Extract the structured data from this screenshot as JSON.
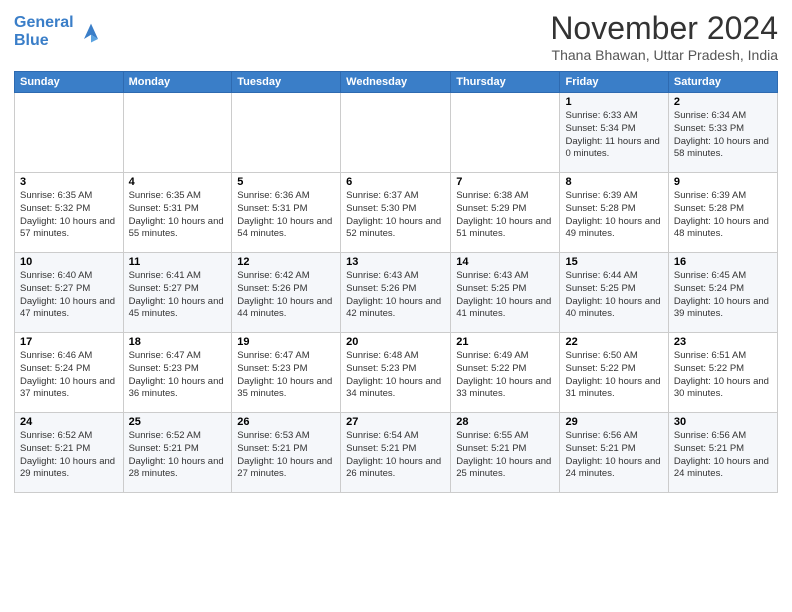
{
  "logo": {
    "line1": "General",
    "line2": "Blue"
  },
  "title": "November 2024",
  "subtitle": "Thana Bhawan, Uttar Pradesh, India",
  "weekdays": [
    "Sunday",
    "Monday",
    "Tuesday",
    "Wednesday",
    "Thursday",
    "Friday",
    "Saturday"
  ],
  "weeks": [
    [
      {
        "day": "",
        "info": ""
      },
      {
        "day": "",
        "info": ""
      },
      {
        "day": "",
        "info": ""
      },
      {
        "day": "",
        "info": ""
      },
      {
        "day": "",
        "info": ""
      },
      {
        "day": "1",
        "info": "Sunrise: 6:33 AM\nSunset: 5:34 PM\nDaylight: 11 hours and 0 minutes."
      },
      {
        "day": "2",
        "info": "Sunrise: 6:34 AM\nSunset: 5:33 PM\nDaylight: 10 hours and 58 minutes."
      }
    ],
    [
      {
        "day": "3",
        "info": "Sunrise: 6:35 AM\nSunset: 5:32 PM\nDaylight: 10 hours and 57 minutes."
      },
      {
        "day": "4",
        "info": "Sunrise: 6:35 AM\nSunset: 5:31 PM\nDaylight: 10 hours and 55 minutes."
      },
      {
        "day": "5",
        "info": "Sunrise: 6:36 AM\nSunset: 5:31 PM\nDaylight: 10 hours and 54 minutes."
      },
      {
        "day": "6",
        "info": "Sunrise: 6:37 AM\nSunset: 5:30 PM\nDaylight: 10 hours and 52 minutes."
      },
      {
        "day": "7",
        "info": "Sunrise: 6:38 AM\nSunset: 5:29 PM\nDaylight: 10 hours and 51 minutes."
      },
      {
        "day": "8",
        "info": "Sunrise: 6:39 AM\nSunset: 5:28 PM\nDaylight: 10 hours and 49 minutes."
      },
      {
        "day": "9",
        "info": "Sunrise: 6:39 AM\nSunset: 5:28 PM\nDaylight: 10 hours and 48 minutes."
      }
    ],
    [
      {
        "day": "10",
        "info": "Sunrise: 6:40 AM\nSunset: 5:27 PM\nDaylight: 10 hours and 47 minutes."
      },
      {
        "day": "11",
        "info": "Sunrise: 6:41 AM\nSunset: 5:27 PM\nDaylight: 10 hours and 45 minutes."
      },
      {
        "day": "12",
        "info": "Sunrise: 6:42 AM\nSunset: 5:26 PM\nDaylight: 10 hours and 44 minutes."
      },
      {
        "day": "13",
        "info": "Sunrise: 6:43 AM\nSunset: 5:26 PM\nDaylight: 10 hours and 42 minutes."
      },
      {
        "day": "14",
        "info": "Sunrise: 6:43 AM\nSunset: 5:25 PM\nDaylight: 10 hours and 41 minutes."
      },
      {
        "day": "15",
        "info": "Sunrise: 6:44 AM\nSunset: 5:25 PM\nDaylight: 10 hours and 40 minutes."
      },
      {
        "day": "16",
        "info": "Sunrise: 6:45 AM\nSunset: 5:24 PM\nDaylight: 10 hours and 39 minutes."
      }
    ],
    [
      {
        "day": "17",
        "info": "Sunrise: 6:46 AM\nSunset: 5:24 PM\nDaylight: 10 hours and 37 minutes."
      },
      {
        "day": "18",
        "info": "Sunrise: 6:47 AM\nSunset: 5:23 PM\nDaylight: 10 hours and 36 minutes."
      },
      {
        "day": "19",
        "info": "Sunrise: 6:47 AM\nSunset: 5:23 PM\nDaylight: 10 hours and 35 minutes."
      },
      {
        "day": "20",
        "info": "Sunrise: 6:48 AM\nSunset: 5:23 PM\nDaylight: 10 hours and 34 minutes."
      },
      {
        "day": "21",
        "info": "Sunrise: 6:49 AM\nSunset: 5:22 PM\nDaylight: 10 hours and 33 minutes."
      },
      {
        "day": "22",
        "info": "Sunrise: 6:50 AM\nSunset: 5:22 PM\nDaylight: 10 hours and 31 minutes."
      },
      {
        "day": "23",
        "info": "Sunrise: 6:51 AM\nSunset: 5:22 PM\nDaylight: 10 hours and 30 minutes."
      }
    ],
    [
      {
        "day": "24",
        "info": "Sunrise: 6:52 AM\nSunset: 5:21 PM\nDaylight: 10 hours and 29 minutes."
      },
      {
        "day": "25",
        "info": "Sunrise: 6:52 AM\nSunset: 5:21 PM\nDaylight: 10 hours and 28 minutes."
      },
      {
        "day": "26",
        "info": "Sunrise: 6:53 AM\nSunset: 5:21 PM\nDaylight: 10 hours and 27 minutes."
      },
      {
        "day": "27",
        "info": "Sunrise: 6:54 AM\nSunset: 5:21 PM\nDaylight: 10 hours and 26 minutes."
      },
      {
        "day": "28",
        "info": "Sunrise: 6:55 AM\nSunset: 5:21 PM\nDaylight: 10 hours and 25 minutes."
      },
      {
        "day": "29",
        "info": "Sunrise: 6:56 AM\nSunset: 5:21 PM\nDaylight: 10 hours and 24 minutes."
      },
      {
        "day": "30",
        "info": "Sunrise: 6:56 AM\nSunset: 5:21 PM\nDaylight: 10 hours and 24 minutes."
      }
    ]
  ]
}
